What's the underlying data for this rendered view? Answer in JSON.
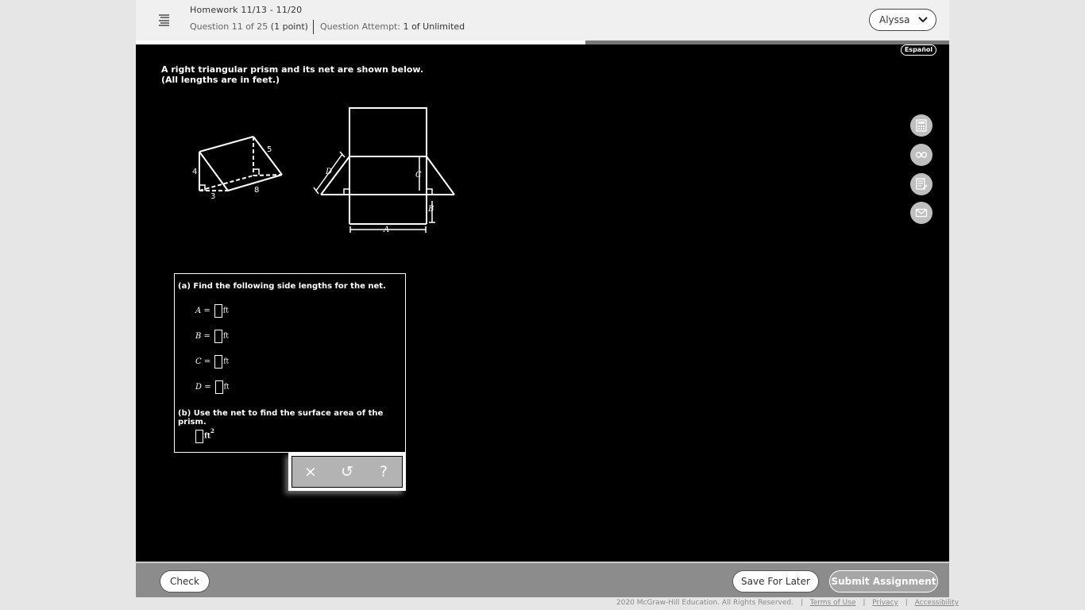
{
  "header": {
    "title": "Homework 11/13 - 11/20",
    "question_label": "Question 11 of 25",
    "points": "(1 point)",
    "attempt_label": "Question Attempt:",
    "attempt_value": "1 of Unlimited",
    "user_name": "Alyssa",
    "progress_fraction": 0.553
  },
  "language_button": "Español",
  "question": {
    "prompt_line1": "A right triangular prism and its net are shown below.",
    "prompt_line2": "(All lengths are in feet.)",
    "figure_labels": {
      "prism_side_4": "4",
      "prism_side_3": "3",
      "prism_side_5": "5",
      "prism_length_8": "8",
      "net_A": "A",
      "net_B": "B",
      "net_C": "C",
      "net_D": "D"
    },
    "part_a": "(a) Find the following side lengths for the net.",
    "rows": [
      {
        "var": "A",
        "eq": " =",
        "unit": "ft"
      },
      {
        "var": "B",
        "eq": " =",
        "unit": "ft"
      },
      {
        "var": "C",
        "eq": " =",
        "unit": "ft"
      },
      {
        "var": "D",
        "eq": " =",
        "unit": "ft"
      }
    ],
    "part_b": "(b) Use the net to find the surface area of the prism.",
    "area_unit": "ft",
    "area_exp": "2"
  },
  "answer_toolbar": {
    "clear": "×",
    "undo": "↺",
    "help": "?"
  },
  "side_tools": [
    "calculator-icon",
    "glasses-icon",
    "notes-icon",
    "mail-icon"
  ],
  "footer": {
    "check": "Check",
    "save": "Save For Later",
    "submit": "Submit Assignment",
    "copyright": "2020 McGraw-Hill Education. All Rights Reserved.",
    "terms": "Terms of Use",
    "privacy": "Privacy",
    "accessibility": "Accessibility"
  },
  "colors": {
    "stage_bg": "#000000",
    "header_bg": "#f0f0f0",
    "footer_bg": "#8c8c8c"
  }
}
